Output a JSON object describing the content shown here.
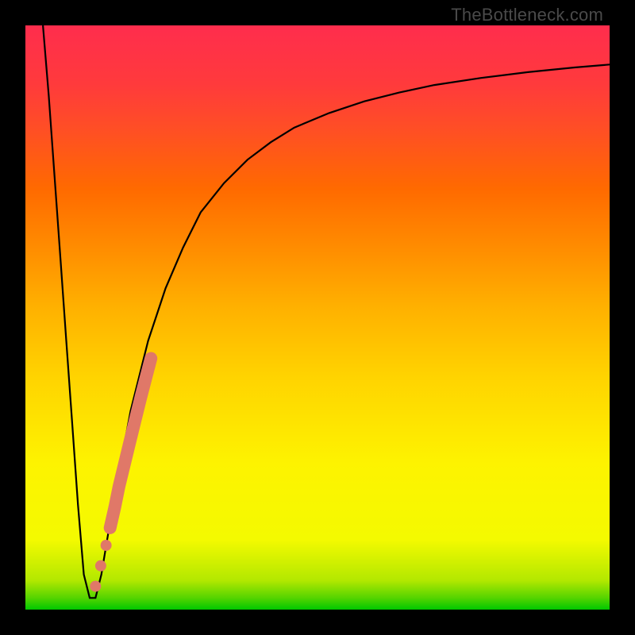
{
  "watermark": "TheBottleneck.com",
  "chart_data": {
    "type": "line",
    "title": "",
    "xlabel": "",
    "ylabel": "",
    "xlim": [
      0,
      100
    ],
    "ylim": [
      0,
      100
    ],
    "grid": false,
    "series": [
      {
        "name": "bottleneck-curve",
        "color": "#000000",
        "x": [
          3,
          4,
          5,
          6,
          7,
          8,
          9,
          10,
          11,
          12,
          13,
          15,
          18,
          21,
          24,
          27,
          30,
          34,
          38,
          42,
          46,
          52,
          58,
          64,
          70,
          78,
          86,
          94,
          100
        ],
        "y": [
          100,
          88,
          74,
          60,
          46,
          32,
          18,
          6,
          2,
          2,
          6,
          18,
          34,
          46,
          55,
          62,
          68,
          73,
          77,
          80,
          82.5,
          85,
          87,
          88.5,
          89.8,
          91,
          92,
          92.8,
          93.3
        ]
      }
    ],
    "highlight_segment": {
      "name": "highlighted-range",
      "color": "#e07868",
      "points": [
        {
          "x": 14.5,
          "y": 14
        },
        {
          "x": 15.3,
          "y": 17.5
        },
        {
          "x": 16.0,
          "y": 21
        },
        {
          "x": 17.7,
          "y": 28
        },
        {
          "x": 18.8,
          "y": 32.5
        },
        {
          "x": 19.8,
          "y": 36.5
        },
        {
          "x": 20.7,
          "y": 40
        },
        {
          "x": 21.5,
          "y": 43
        }
      ],
      "dots": [
        {
          "x": 12.0,
          "y": 4.0
        },
        {
          "x": 12.9,
          "y": 7.5
        },
        {
          "x": 13.8,
          "y": 11.0
        }
      ]
    }
  }
}
